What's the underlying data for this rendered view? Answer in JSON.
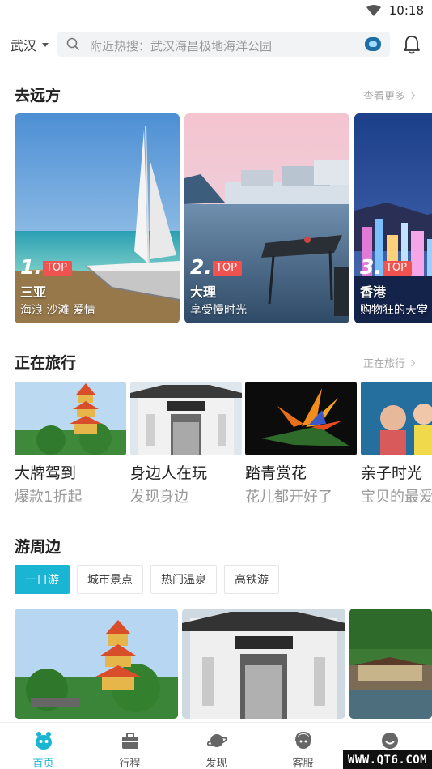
{
  "status": {
    "time": "10:18"
  },
  "header": {
    "city": "武汉",
    "search_placeholder": "附近热搜：武汉海昌极地海洋公园"
  },
  "far": {
    "title": "去远方",
    "more": "查看更多",
    "cards": [
      {
        "rank": "1.",
        "tag": "TOP",
        "name": "三亚",
        "desc": "海浪 沙滩 爱情"
      },
      {
        "rank": "2.",
        "tag": "TOP",
        "name": "大理",
        "desc": "享受慢时光"
      },
      {
        "rank": "3.",
        "tag": "TOP",
        "name": "香港",
        "desc": "购物狂的天堂"
      }
    ]
  },
  "traveling": {
    "title": "正在旅行",
    "more": "正在旅行",
    "tiles": [
      {
        "title": "大牌驾到",
        "sub": "爆款1折起"
      },
      {
        "title": "身边人在玩",
        "sub": "发现身边"
      },
      {
        "title": "踏青赏花",
        "sub": "花儿都开好了"
      },
      {
        "title": "亲子时光",
        "sub": "宝贝的最爱"
      }
    ]
  },
  "nearby": {
    "title": "游周边",
    "pills": [
      "一日游",
      "城市景点",
      "热门温泉",
      "高铁游"
    ],
    "active_pill": 0
  },
  "tabbar": {
    "tabs": [
      {
        "label": "首页",
        "icon": "home-icon"
      },
      {
        "label": "行程",
        "icon": "briefcase-icon"
      },
      {
        "label": "发现",
        "icon": "planet-icon"
      },
      {
        "label": "客服",
        "icon": "headset-icon"
      },
      {
        "label": "",
        "icon": "profile-icon"
      }
    ],
    "active": 0,
    "accent": "#19b5d3"
  },
  "watermark": "WWW.QT6.COM"
}
